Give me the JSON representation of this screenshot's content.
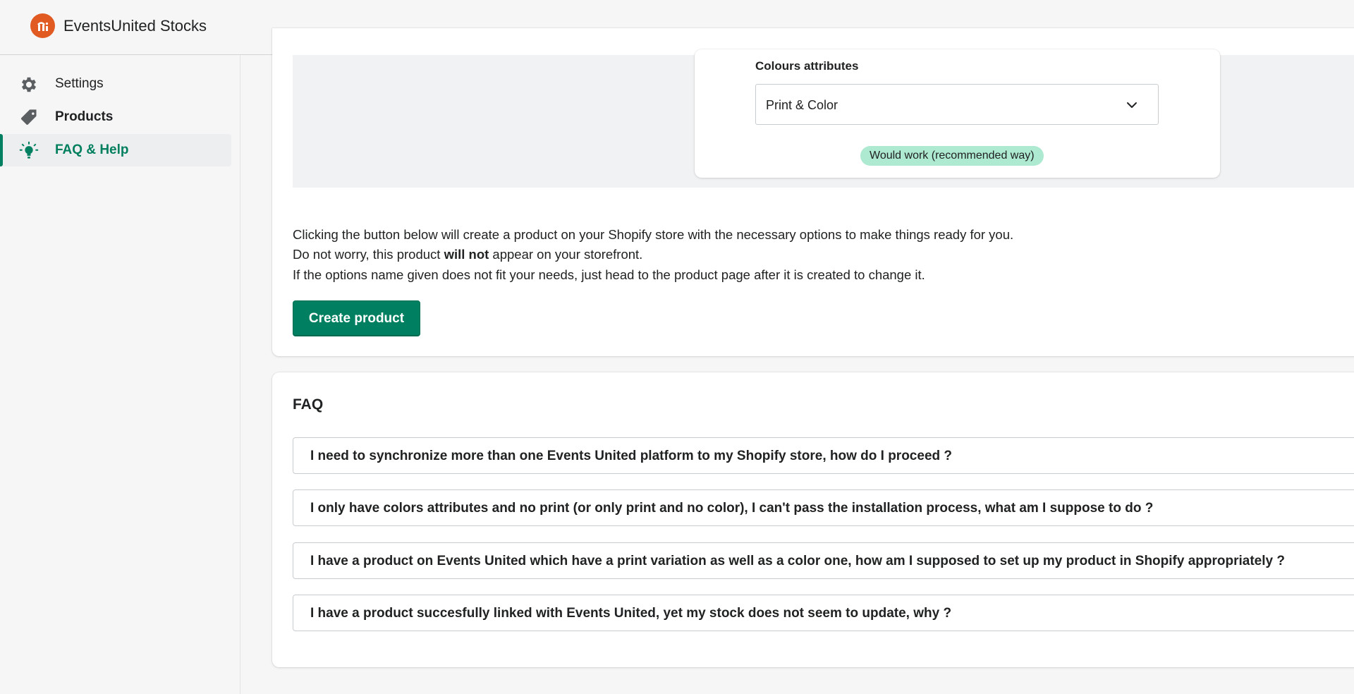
{
  "app": {
    "title": "EventsUnited Stocks",
    "logo_icon": "eventsunited-logo-icon",
    "brand_color": "#e05a22"
  },
  "sidebar": {
    "items": [
      {
        "label": "Settings",
        "icon": "gear-icon",
        "active": false
      },
      {
        "label": "Products",
        "icon": "tag-icon",
        "active": false
      },
      {
        "label": "FAQ & Help",
        "icon": "lightbulb-icon",
        "active": true
      }
    ],
    "accent_color": "#008060"
  },
  "example": {
    "colours_label": "Colours attributes",
    "select_value": "Print & Color",
    "select_icon": "chevron-down-icon",
    "badge": "Would work (recommended way)",
    "badge_color": "#aee9d1"
  },
  "create": {
    "line1": "Clicking the button below will create a product on your Shopify store with the necessary options to make things ready for you.",
    "line2_before": "Do not worry, this product ",
    "line2_bold": "will not",
    "line2_after": " appear on your storefront.",
    "line3": "If the options name given does not fit your needs, just head to the product page after it is created to change it.",
    "button_label": "Create product"
  },
  "faq": {
    "title": "FAQ",
    "questions": [
      "I need to synchronize more than one Events United platform to my Shopify store, how do I proceed ?",
      "I only have colors attributes and no print (or only print and no color), I can't pass the installation process, what am I suppose to do ?",
      "I have a product on Events United which have a print variation as well as a color one, how am I supposed to set up my product in Shopify appropriately ?",
      "I have a product succesfully linked with Events United, yet my stock does not seem to update, why ?"
    ]
  }
}
